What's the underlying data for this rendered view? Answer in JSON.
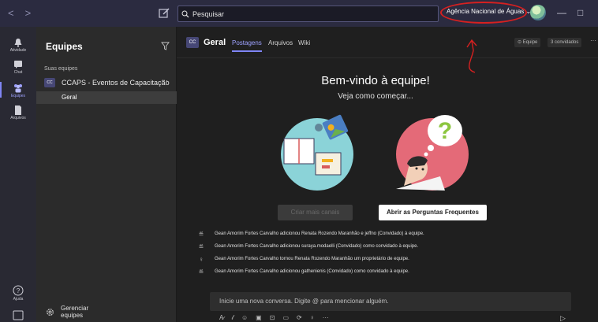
{
  "titlebar": {
    "back_icon": "chevron-left-icon",
    "forward_icon": "chevron-right-icon",
    "search_placeholder": "Pesquisar",
    "org_name": "Agência Nacional de Águas",
    "win_min": "—",
    "win_max": "□"
  },
  "appbar": {
    "items": [
      {
        "label": "Atividade"
      },
      {
        "label": "Chat"
      },
      {
        "label": "Equipes"
      },
      {
        "label": "Arquivos"
      }
    ],
    "help_label": "Ajuda"
  },
  "teams_pane": {
    "title": "Equipes",
    "section_label": "Suas equipes",
    "team_initials": "CC",
    "team_name": "CCAPS - Eventos de Capacitação",
    "team_more": "···",
    "channel": "Geral",
    "manage_label": "Gerenciar equipes"
  },
  "main": {
    "channel_initials": "CC",
    "channel_title": "Geral",
    "tabs": [
      "Postagens",
      "Arquivos",
      "Wiki"
    ],
    "pill_team": "⊙ Equipe",
    "pill_guests": "3 convidados",
    "more": "···",
    "welcome_title": "Bem-vindo à equipe!",
    "welcome_subtitle": "Veja como começar...",
    "btn_create_channels": "Criar mais canais",
    "btn_faq": "Abrir as Perguntas Frequentes",
    "activities": [
      {
        "icon": "≝",
        "text": "Gean Amorim Fortes Carvalho adicionou Renata Rozendo Maranhão e jeffno (Convidado) à equipe."
      },
      {
        "icon": "≝",
        "text": "Gean Amorim Fortes Carvalho adicionou suraya.modaelli (Convidado) como convidado à equipe."
      },
      {
        "icon": "♀",
        "text": "Gean Amorim Fortes Carvalho tornou Renata Rozendo Maranhão um proprietário de equipe."
      },
      {
        "icon": "≝",
        "text": "Gean Amorim Fortes Carvalho adicionou gathenienis (Convidado) como convidado à equipe."
      }
    ],
    "composer_placeholder": "Inicie uma nova conversa. Digite @ para mencionar alguém.",
    "composer_tools": [
      "A̷",
      "𝓁",
      "☺",
      "▣",
      "⊡",
      "▭",
      "⟳",
      "♀",
      "···"
    ],
    "send": "▷"
  },
  "colors": {
    "accent": "#7f85f5",
    "annotation": "#d62020",
    "titlebar": "#2b2b40",
    "background": "#1f1f1f"
  }
}
